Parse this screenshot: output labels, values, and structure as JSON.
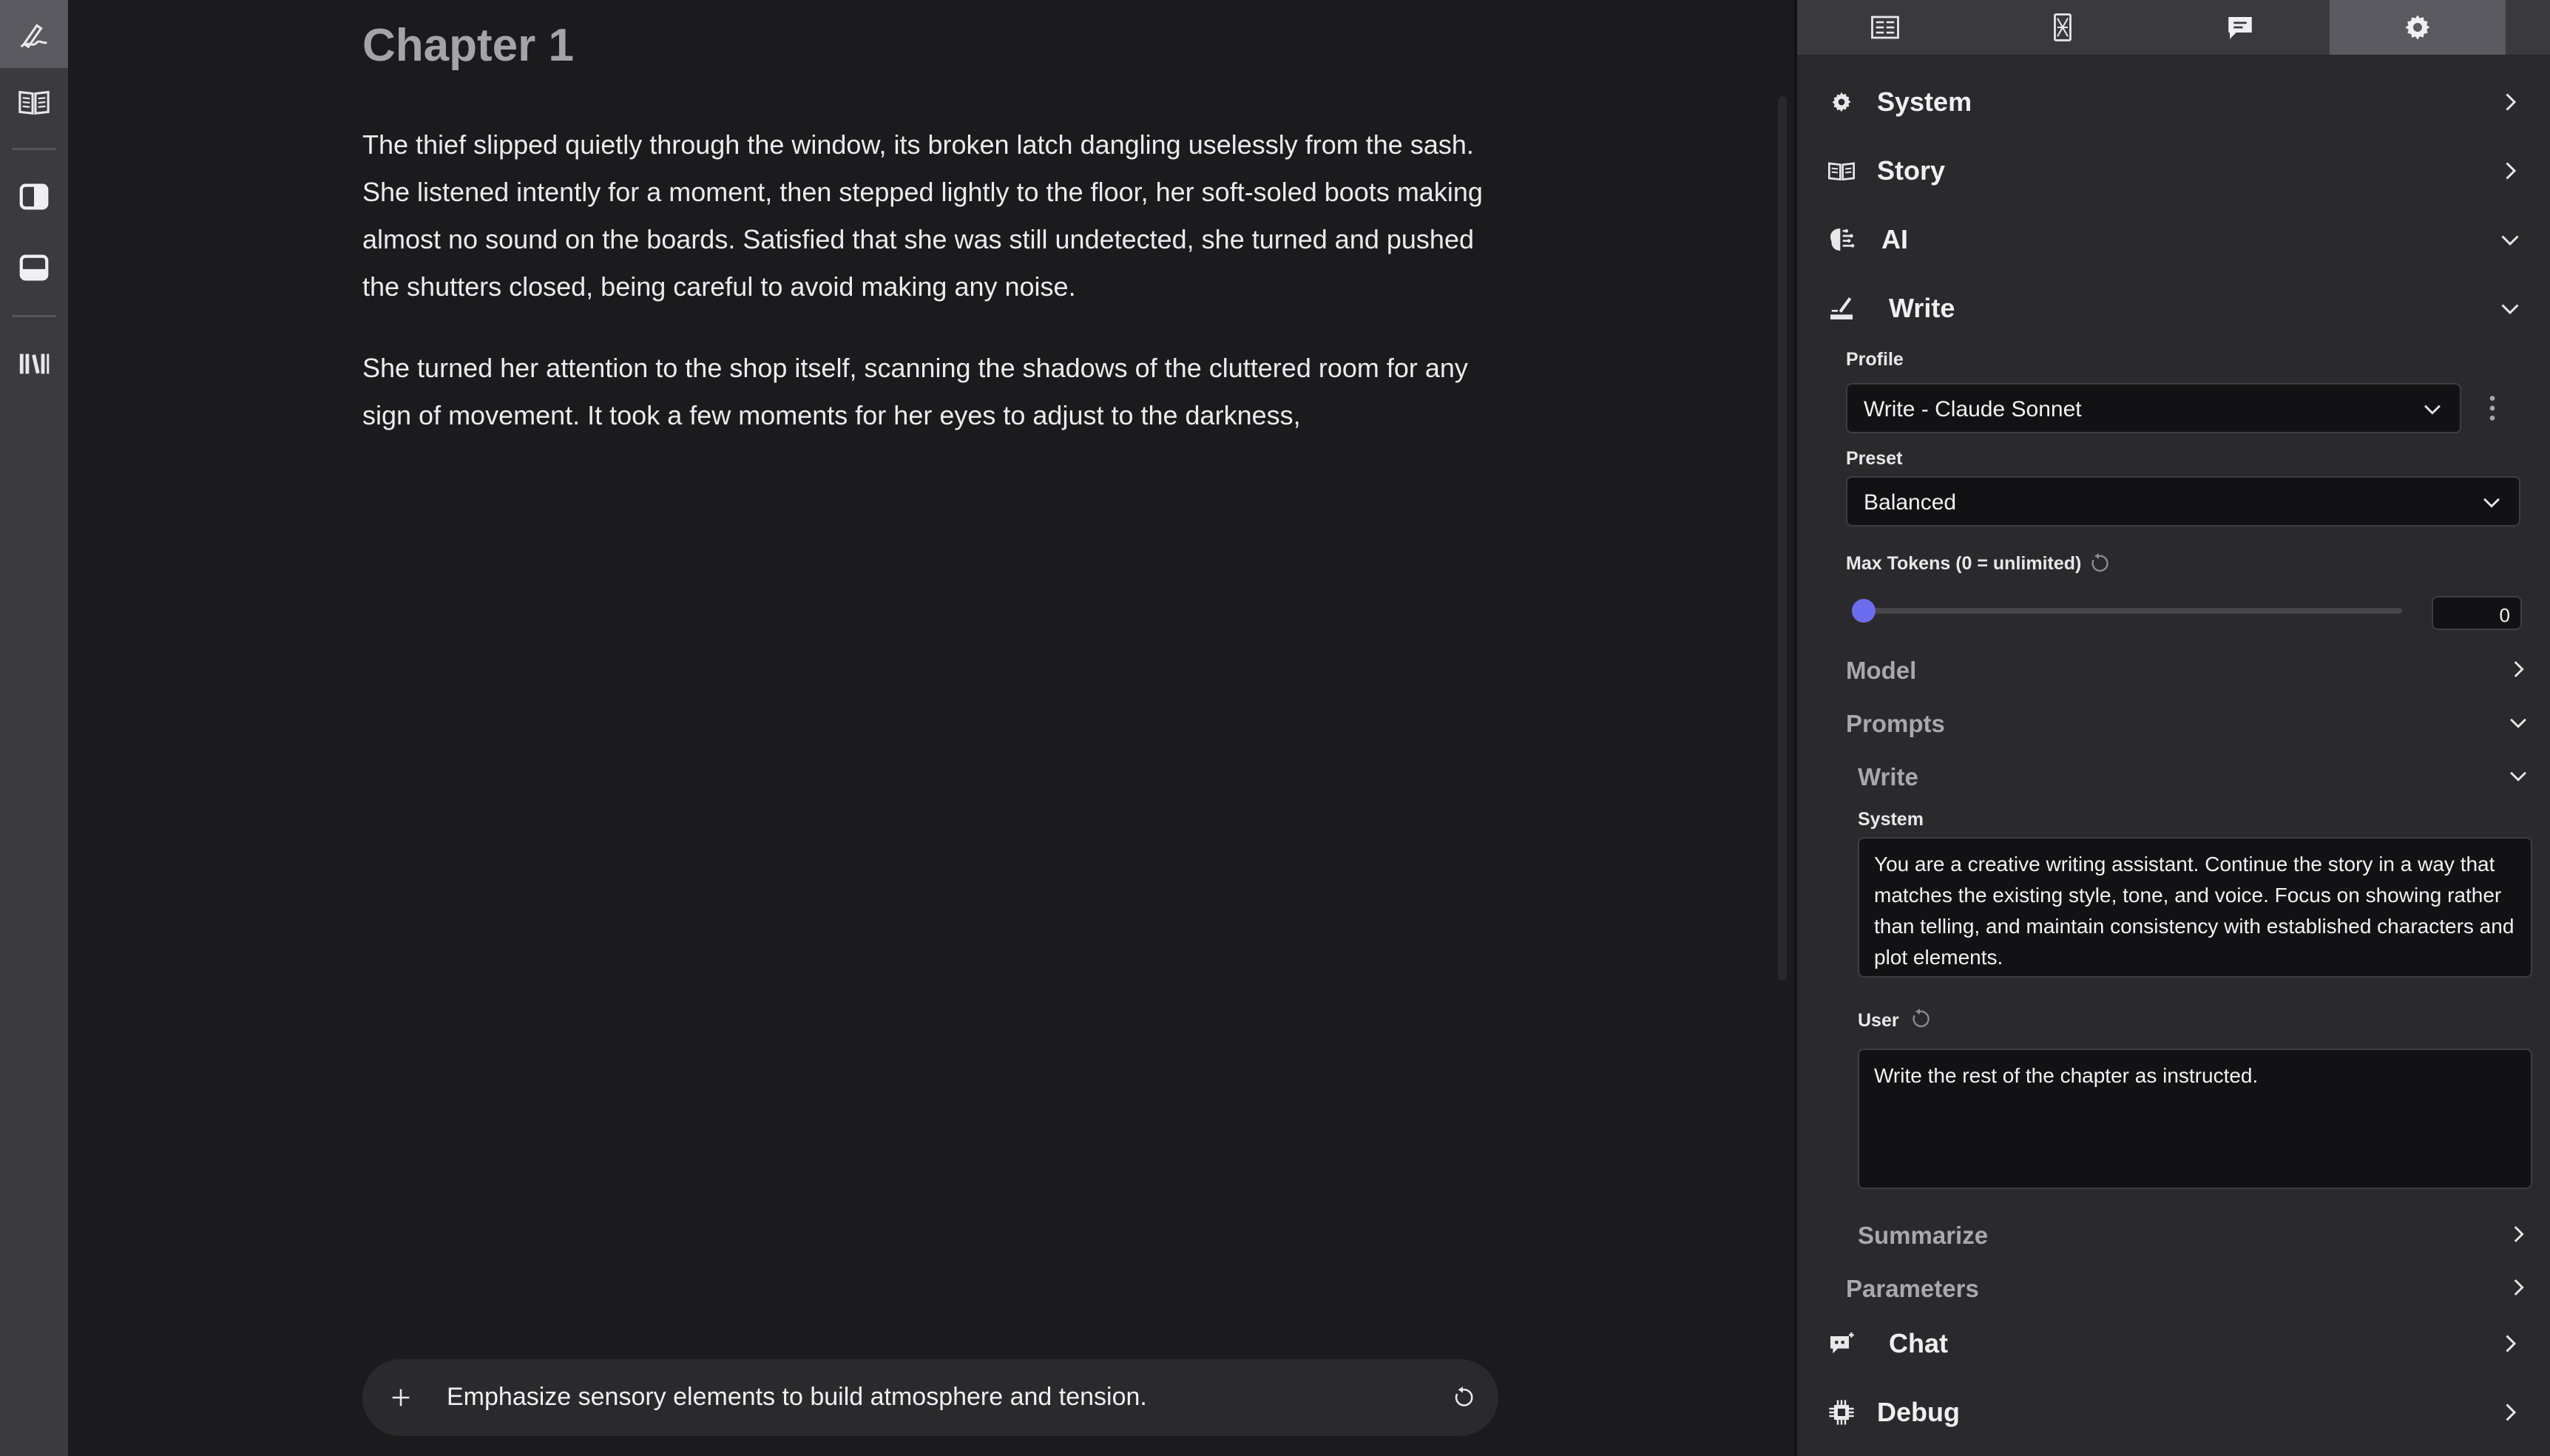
{
  "rail": {
    "items": [
      {
        "name": "write-icon"
      },
      {
        "name": "book-icon"
      },
      {
        "name": "sidebar-panel-icon"
      },
      {
        "name": "bottom-panel-icon"
      },
      {
        "name": "library-icon"
      }
    ]
  },
  "editor": {
    "chapter_title": "Chapter 1",
    "paragraphs": [
      "The thief slipped quietly through the window, its broken latch dangling uselessly from the sash. She listened intently for a moment, then stepped lightly to the floor, her soft-soled boots making almost no sound on the boards. Satisfied that she was still undetected, she turned and pushed the shutters closed, being careful to avoid making any noise.",
      "She turned her attention to the shop itself, scanning the shadows of the cluttered room for any sign of movement. It took a few moments for her eyes to adjust to the darkness,"
    ],
    "prompt": {
      "text": "Emphasize sensory elements to build atmosphere and tension."
    }
  },
  "panel": {
    "tabs": [
      {
        "name": "tab-outline",
        "icon": "outline-icon"
      },
      {
        "name": "tab-codex",
        "icon": "codex-icon"
      },
      {
        "name": "tab-chat",
        "icon": "chat-icon"
      },
      {
        "name": "tab-settings",
        "icon": "gear-icon",
        "active": true
      }
    ],
    "sections": {
      "system": "System",
      "story": "Story",
      "ai": "AI",
      "write": "Write",
      "chat": "Chat",
      "debug": "Debug"
    },
    "write": {
      "profile_label": "Profile",
      "profile_value": "Write - Claude Sonnet",
      "preset_label": "Preset",
      "preset_value": "Balanced",
      "max_tokens_label": "Max Tokens (0 = unlimited)",
      "max_tokens_value": "0",
      "max_tokens_fraction": 0,
      "model_label": "Model",
      "prompts_label": "Prompts",
      "prompts_write_label": "Write",
      "system_label": "System",
      "system_prompt": "You are a creative writing assistant. Continue the story in a way that matches the existing style, tone, and voice. Focus on showing rather than telling, and maintain consistency with established characters and plot elements.",
      "user_label": "User",
      "user_prompt": "Write the rest of the chapter as instructed.",
      "summarize_label": "Summarize",
      "parameters_label": "Parameters"
    }
  },
  "colors": {
    "accent": "#6c6cf0",
    "background": "#1b1b1d",
    "panel": "#2a2a2d"
  }
}
